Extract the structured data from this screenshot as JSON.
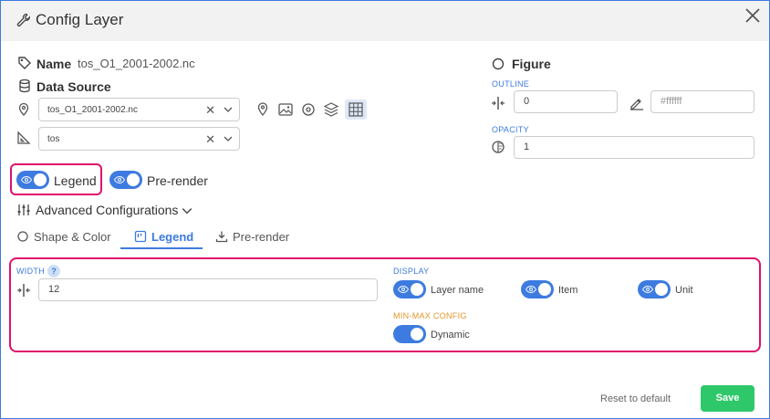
{
  "header": {
    "title": "Config Layer"
  },
  "name": {
    "label": "Name",
    "value": "tos_O1_2001-2002.nc"
  },
  "data_source": {
    "label": "Data Source",
    "file_select": {
      "value": "tos_O1_2001-2002.nc"
    },
    "variable_select": {
      "value": "tos"
    }
  },
  "figure": {
    "label": "Figure",
    "outline": {
      "label": "OUTLINE",
      "width_value": "0",
      "color_placeholder": "#ffffff"
    },
    "opacity": {
      "label": "OPACITY",
      "value": "1"
    }
  },
  "toggles": {
    "legend": "Legend",
    "prerender": "Pre-render"
  },
  "advanced": {
    "label": "Advanced Configurations"
  },
  "tabs": [
    {
      "label": "Shape & Color"
    },
    {
      "label": "Legend"
    },
    {
      "label": "Pre-render"
    }
  ],
  "legend_panel": {
    "width_label": "WIDTH",
    "help": "?",
    "width_value": "12",
    "display_label": "DISPLAY",
    "display_items": [
      {
        "label": "Layer name"
      },
      {
        "label": "Item"
      },
      {
        "label": "Unit"
      }
    ],
    "minmax_label": "MIN-MAX CONFIG",
    "dynamic_label": "Dynamic"
  },
  "footer": {
    "reset": "Reset to default",
    "save": "Save"
  },
  "colors": {
    "accent": "#3d7be0",
    "highlight": "#e0106a",
    "save": "#2ec86a",
    "orange": "#e2962a"
  }
}
